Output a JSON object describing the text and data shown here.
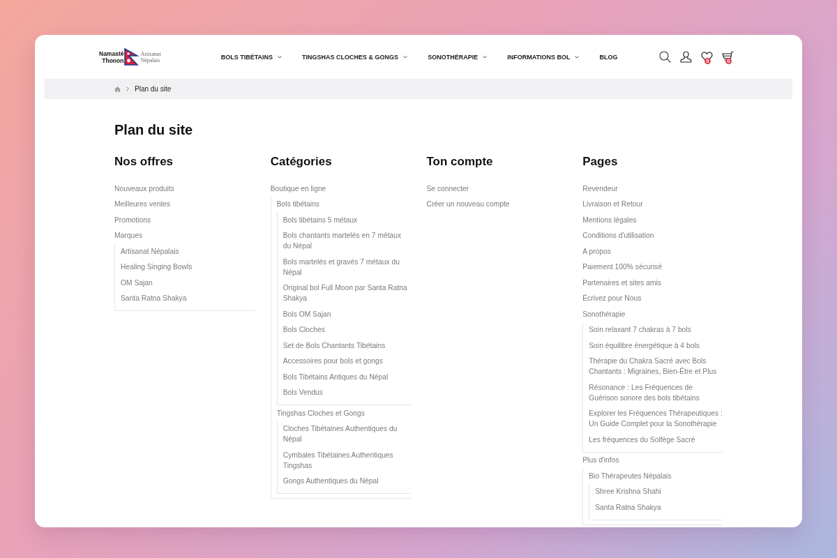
{
  "header": {
    "logo": {
      "name": "Namasté Thonon",
      "tagline": "Artisanat Népalais"
    },
    "nav": [
      {
        "label": "BOLS TIBÉTAINS",
        "dropdown": true
      },
      {
        "label": "TINGSHAS CLOCHES & GONGS",
        "dropdown": true
      },
      {
        "label": "SONOTHÉRAPIE",
        "dropdown": true
      },
      {
        "label": "INFORMATIONS BOL",
        "dropdown": true
      },
      {
        "label": "BLOG",
        "dropdown": false
      }
    ],
    "wishlist_count": "0",
    "cart_count": "0"
  },
  "breadcrumb": {
    "current": "Plan du site"
  },
  "page_title": "Plan du site",
  "columns": [
    {
      "title": "Nos offres",
      "items": [
        {
          "label": "Nouveaux produits"
        },
        {
          "label": "Meilleures ventes"
        },
        {
          "label": "Promotions"
        },
        {
          "label": "Marques",
          "children": [
            {
              "label": "Artisanat Népalais"
            },
            {
              "label": "Healing Singing Bowls"
            },
            {
              "label": "OM Sajan"
            },
            {
              "label": "Santa Ratna Shakya"
            }
          ]
        }
      ]
    },
    {
      "title": "Catégories",
      "items": [
        {
          "label": "Boutique en ligne",
          "children": [
            {
              "label": "Bols tibétains",
              "children": [
                {
                  "label": "Bols tibétains 5 métaux"
                },
                {
                  "label": "Bols chantants martelés en 7 métaux du Népal"
                },
                {
                  "label": "Bols martelés et gravés 7 métaux du Népal"
                },
                {
                  "label": "Original bol Full Moon par Santa Ratna Shakya"
                },
                {
                  "label": "Bols OM Sajan"
                },
                {
                  "label": "Bols Cloches"
                },
                {
                  "label": "Set de Bols Chantants Tibétains"
                },
                {
                  "label": "Accessoires pour bols et gongs"
                },
                {
                  "label": "Bols Tibétains Antiques du Népal"
                },
                {
                  "label": "Bols Vendus"
                }
              ]
            },
            {
              "label": "Tingshas Cloches et Gongs",
              "children": [
                {
                  "label": "Cloches Tibétaines Authentiques du Népal"
                },
                {
                  "label": "Cymbales Tibétaines Authentiques Tingshas"
                },
                {
                  "label": "Gongs Authentiques du Népal"
                }
              ]
            }
          ]
        }
      ]
    },
    {
      "title": "Ton compte",
      "items": [
        {
          "label": "Se connecter"
        },
        {
          "label": "Créer un nouveau compte"
        }
      ]
    },
    {
      "title": "Pages",
      "items": [
        {
          "label": "Revendeur"
        },
        {
          "label": "Livraison et Retour"
        },
        {
          "label": "Mentions légales"
        },
        {
          "label": "Conditions d'utilisation"
        },
        {
          "label": "A propos"
        },
        {
          "label": "Paiement 100% sécurisé"
        },
        {
          "label": "Partenaires et sites amis"
        },
        {
          "label": "Écrivez pour Nous"
        },
        {
          "label": "Sonothérapie",
          "children": [
            {
              "label": "Soin relaxant 7 chakras à 7 bols"
            },
            {
              "label": "Soin équilibre énergétique à 4 bols"
            },
            {
              "label": "Thérapie du Chakra Sacré avec Bols Chantants : Migraines, Bien-Être et Plus"
            },
            {
              "label": "Résonance : Les Fréquences de Guérison sonore des bols tibétains"
            },
            {
              "label": "Explorer les Fréquences Thérapeutiques : Un Guide Complet pour la Sonothérapie"
            },
            {
              "label": "Les fréquences du Solfège Sacré"
            }
          ]
        },
        {
          "label": "Plus d'infos",
          "children": [
            {
              "label": "Bio Thérapeutes Népalais",
              "children": [
                {
                  "label": "Shree Krishna Shahi"
                },
                {
                  "label": "Santa Ratna Shakya"
                }
              ]
            }
          ]
        }
      ]
    }
  ]
}
